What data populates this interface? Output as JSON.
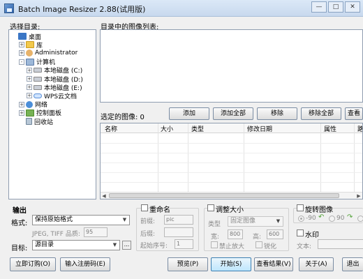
{
  "window": {
    "title": "Batch Image Resizer 2.88(试用版)"
  },
  "dir_panel": {
    "label": "选择目录:",
    "tree": [
      {
        "label": "桌面",
        "icon": "desktop-icon",
        "expander": "",
        "indent": 0
      },
      {
        "label": "库",
        "icon": "folder-icon",
        "expander": "+",
        "indent": 1
      },
      {
        "label": "Administrator",
        "icon": "user-icon",
        "expander": "+",
        "indent": 1
      },
      {
        "label": "计算机",
        "icon": "computer-icon",
        "expander": "-",
        "indent": 1
      },
      {
        "label": "本地磁盘 (C:)",
        "icon": "drive-icon",
        "expander": "+",
        "indent": 2
      },
      {
        "label": "本地磁盘 (D:)",
        "icon": "drive-icon",
        "expander": "+",
        "indent": 2
      },
      {
        "label": "本地磁盘 (E:)",
        "icon": "drive-icon",
        "expander": "+",
        "indent": 2
      },
      {
        "label": "WPS云文档",
        "icon": "cloud-icon",
        "expander": "+",
        "indent": 2
      },
      {
        "label": "网络",
        "icon": "network-icon",
        "expander": "+",
        "indent": 1
      },
      {
        "label": "控制面板",
        "icon": "control-panel-icon",
        "expander": "+",
        "indent": 1
      },
      {
        "label": "回收站",
        "icon": "recycle-bin-icon",
        "expander": "",
        "indent": 1
      }
    ]
  },
  "image_list": {
    "label": "目录中的图像列表:"
  },
  "selected": {
    "label": "选定的图像: 0",
    "buttons": {
      "add": "添加",
      "add_all": "添加全部",
      "remove": "移除",
      "remove_all": "移除全部",
      "view": "查看"
    },
    "columns": [
      "名称",
      "大小",
      "类型",
      "修改日期",
      "属性",
      "路"
    ]
  },
  "output": {
    "label": "输出",
    "format_label": "格式:",
    "format_value": "保持原始格式",
    "quality_label": "JPEG, TIFF 品质:",
    "quality_value": "95",
    "target_label": "目标:",
    "target_value": "源目录",
    "browse": "..."
  },
  "rename": {
    "label": "重命名",
    "prefix_label": "前缀:",
    "prefix_value": "pic",
    "suffix_label": "后缀:",
    "suffix_value": "",
    "start_label": "起始序号:",
    "start_value": "1"
  },
  "resize": {
    "label": "调整大小",
    "type_label": "类型",
    "type_value": "固定图像",
    "width_label": "宽:",
    "width_value": "800",
    "height_label": "高:",
    "height_value": "600",
    "no_enlarge": "禁止放大",
    "sharpen": "锐化"
  },
  "rotate": {
    "label": "旋转图像",
    "opt_ccw": "-90",
    "opt_cw": "90"
  },
  "watermark": {
    "label": "水印",
    "text_label": "文本:",
    "text_value": ""
  },
  "bottom": {
    "buy": "立即订购(O)",
    "register": "输入注册码(E)",
    "preview": "预览(P)",
    "start": "开始(S)",
    "results": "查看结果(V)",
    "about": "关于(A)",
    "exit": "退出"
  }
}
